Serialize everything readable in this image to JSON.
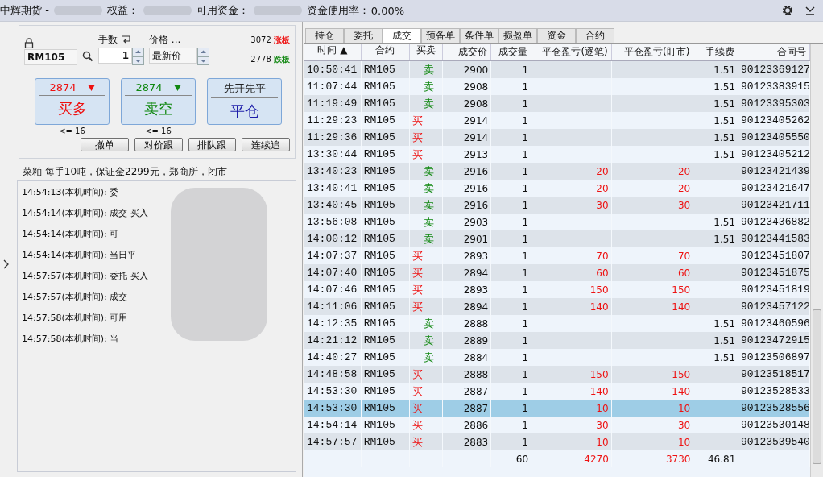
{
  "title_bar": {
    "company": "中辉期货 -",
    "equity_label": "权益：",
    "available_label": "可用资金：",
    "usage_label": "资金使用率：",
    "usage_value": "0.00%"
  },
  "order_panel": {
    "lots_label": "手数",
    "price_label": "价格 ...",
    "contract": "RM105",
    "lots": "1",
    "price_type": "最新价",
    "limit_up_price": "3072",
    "limit_up_label": "涨板",
    "limit_down_price": "2778",
    "limit_down_label": "跌板",
    "big_buttons": [
      {
        "kind": "buy",
        "price": "2874",
        "action": "买多",
        "limit": "<= 16"
      },
      {
        "kind": "sell",
        "price": "2874",
        "action": "卖空",
        "limit": "<= 16"
      },
      {
        "kind": "close",
        "price": "先开先平",
        "action": "平仓"
      }
    ],
    "small_buttons": [
      "撤单",
      "对价跟",
      "排队跟",
      "连续追"
    ]
  },
  "info_line": "菜粕  每手10吨，保证金2299元，郑商所，闭市",
  "log": [
    "14:54:13(本机时间): 委",
    "14:54:14(本机时间): 成交  买入",
    "14:54:14(本机时间): 可",
    "14:54:14(本机时间): 当日平",
    "14:57:57(本机时间): 委托  买入",
    "14:57:57(本机时间): 成交",
    "14:57:58(本机时间): 可用",
    "14:57:58(本机时间): 当"
  ],
  "tabs": [
    {
      "label": "持仓",
      "selected": false
    },
    {
      "label": "委托",
      "selected": false
    },
    {
      "label": "成交",
      "selected": true
    },
    {
      "label": "预备单",
      "selected": false
    },
    {
      "label": "条件单",
      "selected": false
    },
    {
      "label": "损盈单",
      "selected": false
    },
    {
      "label": "资金",
      "selected": false
    },
    {
      "label": "合约",
      "selected": false
    }
  ],
  "table": {
    "columns": [
      "时间 ▲",
      "合约",
      "买卖",
      "成交价",
      "成交量",
      "平仓盈亏(逐笔)",
      "平仓盈亏(盯市)",
      "手续费",
      "合同号"
    ],
    "rows": [
      {
        "time": "10:50:41",
        "contract": "RM105",
        "side": "卖",
        "kind": "sell",
        "price": "2900",
        "qty": "1",
        "pnl_trade": "",
        "pnl_mark": "",
        "fee": "1.51",
        "order_no": "90123369127",
        "selected": false
      },
      {
        "time": "11:07:44",
        "contract": "RM105",
        "side": "卖",
        "kind": "sell",
        "price": "2908",
        "qty": "1",
        "pnl_trade": "",
        "pnl_mark": "",
        "fee": "1.51",
        "order_no": "90123383915",
        "selected": false
      },
      {
        "time": "11:19:49",
        "contract": "RM105",
        "side": "卖",
        "kind": "sell",
        "price": "2908",
        "qty": "1",
        "pnl_trade": "",
        "pnl_mark": "",
        "fee": "1.51",
        "order_no": "90123395303",
        "selected": false
      },
      {
        "time": "11:29:23",
        "contract": "RM105",
        "side": "买",
        "kind": "buy",
        "price": "2914",
        "qty": "1",
        "pnl_trade": "",
        "pnl_mark": "",
        "fee": "1.51",
        "order_no": "90123405262",
        "selected": false
      },
      {
        "time": "11:29:36",
        "contract": "RM105",
        "side": "买",
        "kind": "buy",
        "price": "2914",
        "qty": "1",
        "pnl_trade": "",
        "pnl_mark": "",
        "fee": "1.51",
        "order_no": "90123405550",
        "selected": false
      },
      {
        "time": "13:30:44",
        "contract": "RM105",
        "side": "买",
        "kind": "buy",
        "price": "2913",
        "qty": "1",
        "pnl_trade": "",
        "pnl_mark": "",
        "fee": "1.51",
        "order_no": "90123405212",
        "selected": false
      },
      {
        "time": "13:40:23",
        "contract": "RM105",
        "side": "卖",
        "kind": "sell",
        "price": "2916",
        "qty": "1",
        "pnl_trade": "20",
        "pnl_mark": "20",
        "fee": "",
        "order_no": "90123421439",
        "selected": false
      },
      {
        "time": "13:40:41",
        "contract": "RM105",
        "side": "卖",
        "kind": "sell",
        "price": "2916",
        "qty": "1",
        "pnl_trade": "20",
        "pnl_mark": "20",
        "fee": "",
        "order_no": "90123421647",
        "selected": false
      },
      {
        "time": "13:40:45",
        "contract": "RM105",
        "side": "卖",
        "kind": "sell",
        "price": "2916",
        "qty": "1",
        "pnl_trade": "30",
        "pnl_mark": "30",
        "fee": "",
        "order_no": "90123421711",
        "selected": false
      },
      {
        "time": "13:56:08",
        "contract": "RM105",
        "side": "卖",
        "kind": "sell",
        "price": "2903",
        "qty": "1",
        "pnl_trade": "",
        "pnl_mark": "",
        "fee": "1.51",
        "order_no": "90123436882",
        "selected": false
      },
      {
        "time": "14:00:12",
        "contract": "RM105",
        "side": "卖",
        "kind": "sell",
        "price": "2901",
        "qty": "1",
        "pnl_trade": "",
        "pnl_mark": "",
        "fee": "1.51",
        "order_no": "90123441583",
        "selected": false
      },
      {
        "time": "14:07:37",
        "contract": "RM105",
        "side": "买",
        "kind": "buy",
        "price": "2893",
        "qty": "1",
        "pnl_trade": "70",
        "pnl_mark": "70",
        "fee": "",
        "order_no": "90123451807",
        "selected": false
      },
      {
        "time": "14:07:40",
        "contract": "RM105",
        "side": "买",
        "kind": "buy",
        "price": "2894",
        "qty": "1",
        "pnl_trade": "60",
        "pnl_mark": "60",
        "fee": "",
        "order_no": "90123451875",
        "selected": false
      },
      {
        "time": "14:07:46",
        "contract": "RM105",
        "side": "买",
        "kind": "buy",
        "price": "2893",
        "qty": "1",
        "pnl_trade": "150",
        "pnl_mark": "150",
        "fee": "",
        "order_no": "90123451819",
        "selected": false
      },
      {
        "time": "14:11:06",
        "contract": "RM105",
        "side": "买",
        "kind": "buy",
        "price": "2894",
        "qty": "1",
        "pnl_trade": "140",
        "pnl_mark": "140",
        "fee": "",
        "order_no": "90123457122",
        "selected": false
      },
      {
        "time": "14:12:35",
        "contract": "RM105",
        "side": "卖",
        "kind": "sell",
        "price": "2888",
        "qty": "1",
        "pnl_trade": "",
        "pnl_mark": "",
        "fee": "1.51",
        "order_no": "90123460596",
        "selected": false
      },
      {
        "time": "14:21:12",
        "contract": "RM105",
        "side": "卖",
        "kind": "sell",
        "price": "2889",
        "qty": "1",
        "pnl_trade": "",
        "pnl_mark": "",
        "fee": "1.51",
        "order_no": "90123472915",
        "selected": false
      },
      {
        "time": "14:40:27",
        "contract": "RM105",
        "side": "卖",
        "kind": "sell",
        "price": "2884",
        "qty": "1",
        "pnl_trade": "",
        "pnl_mark": "",
        "fee": "1.51",
        "order_no": "90123506897",
        "selected": false
      },
      {
        "time": "14:48:58",
        "contract": "RM105",
        "side": "买",
        "kind": "buy",
        "price": "2888",
        "qty": "1",
        "pnl_trade": "150",
        "pnl_mark": "150",
        "fee": "",
        "order_no": "90123518517",
        "selected": false
      },
      {
        "time": "14:53:30",
        "contract": "RM105",
        "side": "买",
        "kind": "buy",
        "price": "2887",
        "qty": "1",
        "pnl_trade": "140",
        "pnl_mark": "140",
        "fee": "",
        "order_no": "90123528533",
        "selected": false
      },
      {
        "time": "14:53:30",
        "contract": "RM105",
        "side": "买",
        "kind": "buy",
        "price": "2887",
        "qty": "1",
        "pnl_trade": "10",
        "pnl_mark": "10",
        "fee": "",
        "order_no": "90123528556",
        "selected": true
      },
      {
        "time": "14:54:14",
        "contract": "RM105",
        "side": "买",
        "kind": "buy",
        "price": "2886",
        "qty": "1",
        "pnl_trade": "30",
        "pnl_mark": "30",
        "fee": "",
        "order_no": "90123530148",
        "selected": false
      },
      {
        "time": "14:57:57",
        "contract": "RM105",
        "side": "买",
        "kind": "buy",
        "price": "2883",
        "qty": "1",
        "pnl_trade": "10",
        "pnl_mark": "10",
        "fee": "",
        "order_no": "90123539540",
        "selected": false
      }
    ],
    "totals": {
      "qty": "60",
      "pnl_trade": "4270",
      "pnl_mark": "3730",
      "fee": "46.81"
    }
  }
}
